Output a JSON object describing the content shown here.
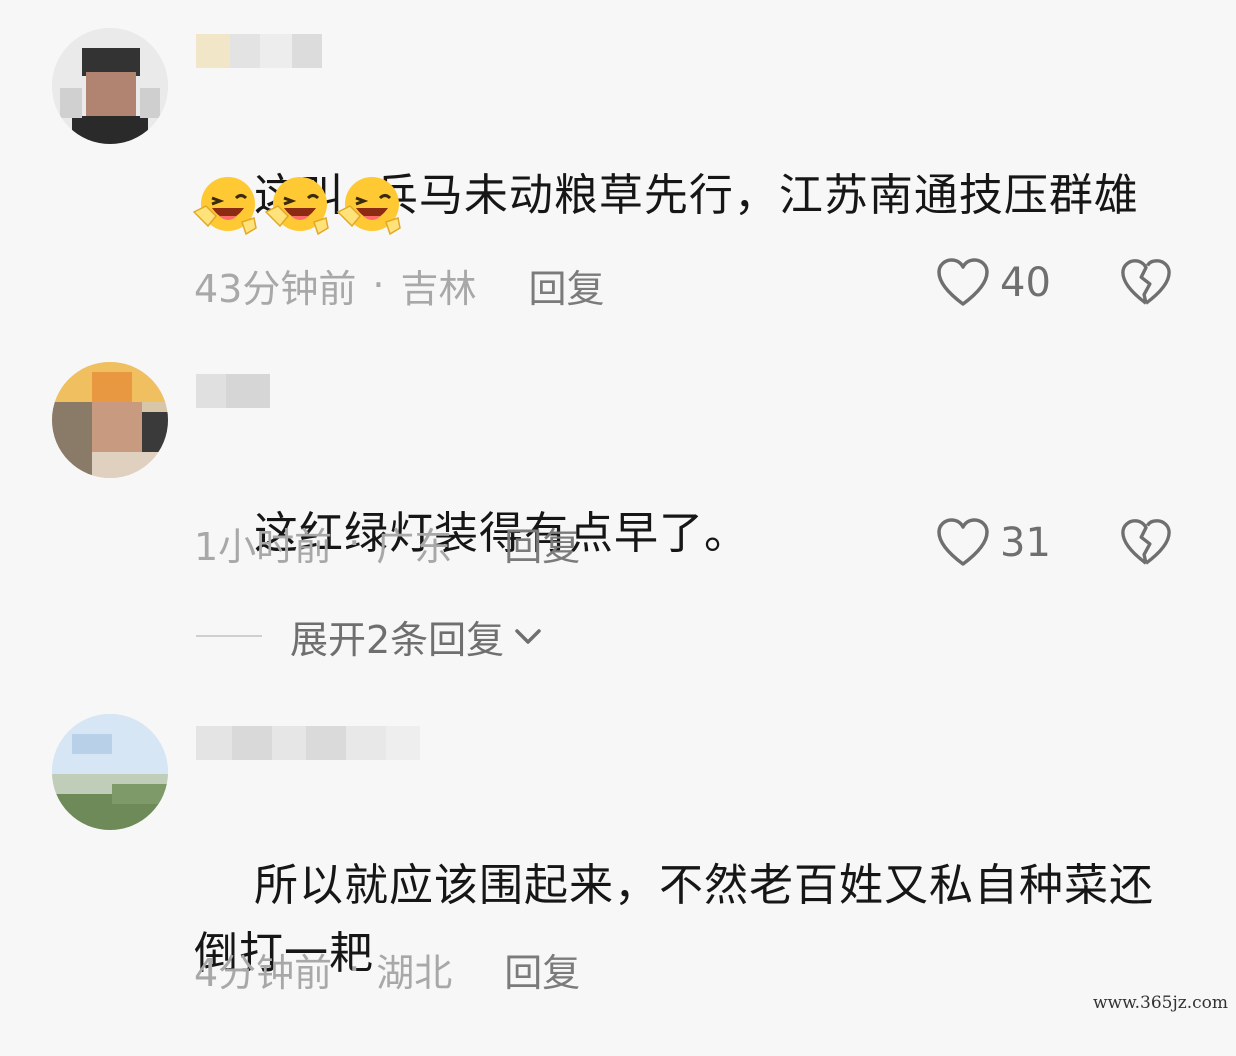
{
  "comments": [
    {
      "text": "这叫  兵马未动粮草先行，江苏南通技压群雄",
      "emoji": [
        "laughing-wink-emoji",
        "laughing-wink-emoji",
        "laughing-wink-emoji"
      ],
      "time": "43分钟前",
      "separator": "·",
      "location": "吉林",
      "reply_label": "回复",
      "likes": "40"
    },
    {
      "text": "这红绿灯装得有点早了。",
      "time": "1小时前",
      "separator": "·",
      "location": "广东",
      "reply_label": "回复",
      "likes": "31"
    },
    {
      "text": "所以就应该围起来，不然老百姓又私自种菜还\n倒打一耙",
      "time": "4分钟前",
      "separator": "·",
      "location": "湖北",
      "reply_label": "回复"
    }
  ],
  "expand_replies": {
    "label": "展开2条回复"
  },
  "watermark": "www.365jz.com",
  "colors": {
    "background": "#f7f7f7",
    "text": "#161616",
    "meta": "#a8a8a8",
    "icon": "#6f6f6f"
  }
}
